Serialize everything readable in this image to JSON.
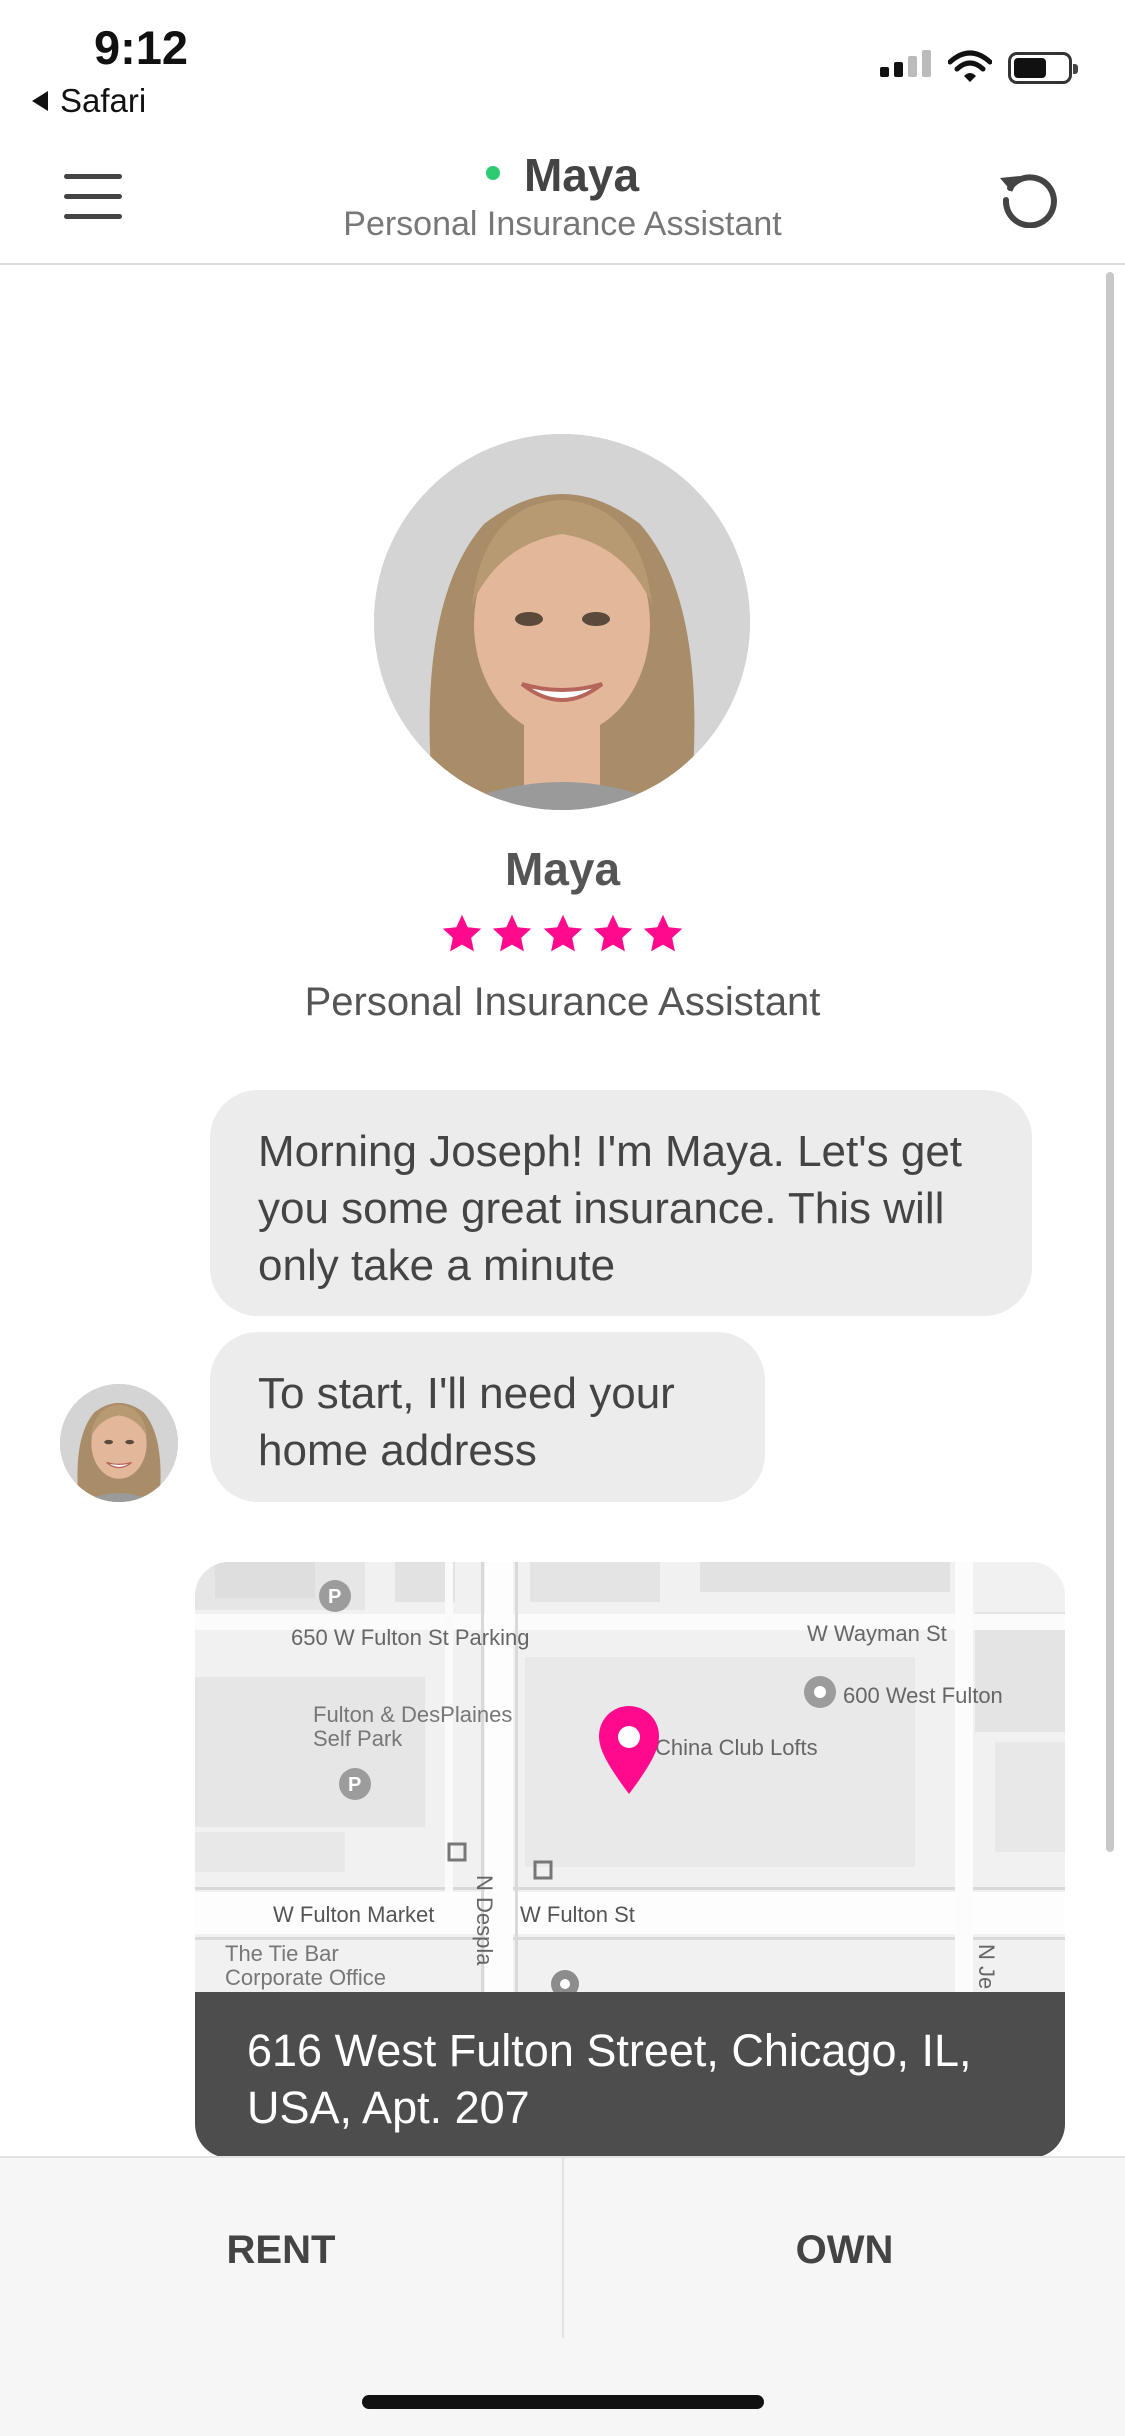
{
  "status_bar": {
    "time": "9:12",
    "back_app": "Safari"
  },
  "header": {
    "title": "Maya",
    "subtitle": "Personal Insurance Assistant",
    "online_color": "#2ecc71"
  },
  "profile": {
    "name": "Maya",
    "rating": 5,
    "rating_max": 5,
    "star_color": "#ff0a8c",
    "subtitle": "Personal Insurance Assistant"
  },
  "messages": [
    {
      "text": "Morning Joseph! I'm Maya. Let's get you some great insurance. This will only take a minute"
    },
    {
      "text": "To start, I'll need your home address"
    }
  ],
  "map": {
    "labels": {
      "parking": "650 W Fulton St Parking",
      "wayman": "W Wayman St",
      "west_fulton": "600 West Fulton",
      "fulton_desplaines_1": "Fulton & DesPlaines",
      "fulton_desplaines_2": "Self Park",
      "china_club": "China Club Lofts",
      "fulton_market": "W Fulton Market",
      "fulton_st": "W Fulton St",
      "tie_bar_1": "The Tie Bar",
      "tie_bar_2": "Corporate Office",
      "desplaines": "N Despla",
      "nje": "N Je"
    },
    "pin_color": "#ff0a8c",
    "address": "616 West Fulton Street, Chicago, IL, USA, Apt. 207"
  },
  "options": {
    "rent": "RENT",
    "own": "OWN"
  }
}
